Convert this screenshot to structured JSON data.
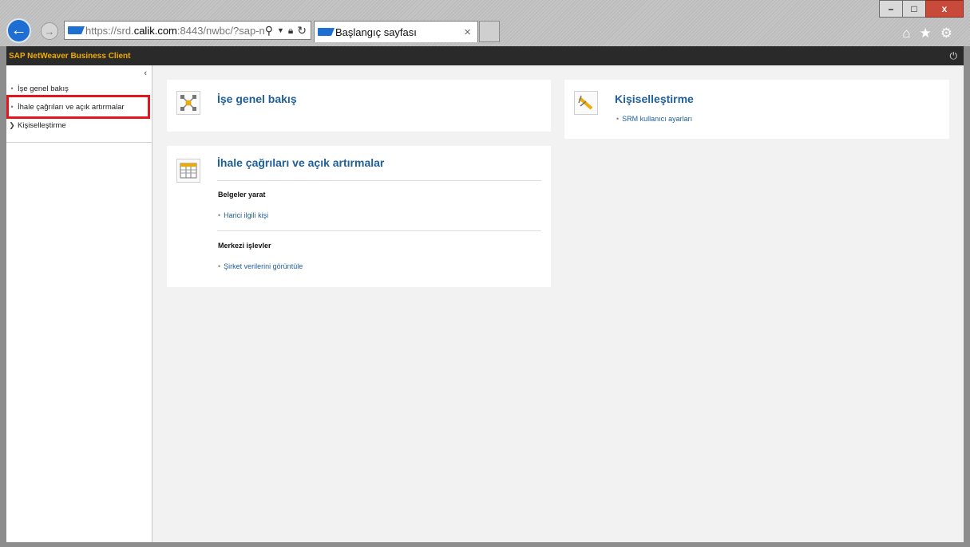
{
  "window": {
    "minimize": "–",
    "maximize": "□",
    "close": "x"
  },
  "browser": {
    "address": {
      "prefix": "https://srd.",
      "domain": "calik.com",
      "rest": ":8443/nwbc/?sap-n"
    },
    "tab_title": "Başlangıç sayfası",
    "tab_close": "×"
  },
  "sap": {
    "header_title": "SAP NetWeaver Business Client"
  },
  "sidebar": {
    "collapse": "‹",
    "items": [
      {
        "label": "İşe genel bakış"
      },
      {
        "label": "İhale çağrıları ve açık artırmalar"
      },
      {
        "label": "Kişiselleştirme"
      }
    ]
  },
  "cards": {
    "overview": {
      "title": "İşe genel bakış"
    },
    "personalization": {
      "title": "Kişiselleştirme",
      "link": "SRM kullanıcı ayarları"
    },
    "tenders": {
      "title": "İhale çağrıları ve açık artırmalar",
      "section1": "Belgeler yarat",
      "link1": "Harici ilgili kişi",
      "section2": "Merkezi işlevler",
      "link2": "Şirket verilerini görüntüle"
    }
  },
  "colors": {
    "sap_header_bg": "#2a2a2a",
    "sap_title": "#f0ab00",
    "link": "#1f5f9a",
    "highlight": "#e5151d"
  }
}
